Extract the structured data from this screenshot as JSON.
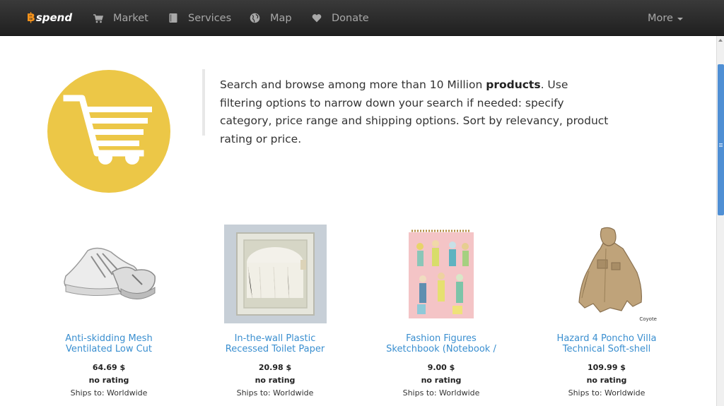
{
  "nav": {
    "brand_symbol": "฿",
    "brand_text": "spend",
    "items": [
      {
        "label": "Market",
        "icon": "cart-icon"
      },
      {
        "label": "Services",
        "icon": "book-icon"
      },
      {
        "label": "Map",
        "icon": "globe-icon"
      },
      {
        "label": "Donate",
        "icon": "heart-icon"
      }
    ],
    "more_label": "More"
  },
  "intro": {
    "text_before": "Search and browse among more than 10 Million ",
    "bold": "products",
    "text_after": ". Use filtering options to narrow down your search if needed: specify category, price range and shipping options. Sort by relevancy, product rating or price.",
    "icon": "shopping-cart-icon",
    "icon_bg": "#ecc747"
  },
  "products": [
    {
      "title_line1": "Anti-skidding Mesh",
      "title_line2": "Ventilated Low Cut",
      "price": "64.69 $",
      "rating": "no rating",
      "ships": "Ships to: Worldwide",
      "image": "white-sneaker-image"
    },
    {
      "title_line1": "In-the-wall Plastic",
      "title_line2": "Recessed Toilet Paper",
      "price": "20.98 $",
      "rating": "no rating",
      "ships": "Ships to: Worldwide",
      "image": "toilet-paper-holder-image"
    },
    {
      "title_line1": "Fashion Figures",
      "title_line2": "Sketchbook (Notebook /",
      "price": "9.00 $",
      "rating": "no rating",
      "ships": "Ships to: Worldwide",
      "image": "fashion-sketchbook-image"
    },
    {
      "title_line1": "Hazard 4 Poncho Villa",
      "title_line2": "Technical Soft-shell",
      "price": "109.99 $",
      "rating": "no rating",
      "ships": "Ships to: Worldwide",
      "image": "poncho-image",
      "image_caption": "Coyote"
    }
  ],
  "colors": {
    "link": "#3a8fd0",
    "navbar": "#262626",
    "brand_accent": "#f7931a",
    "scroll_thumb": "#4f8fd4"
  }
}
